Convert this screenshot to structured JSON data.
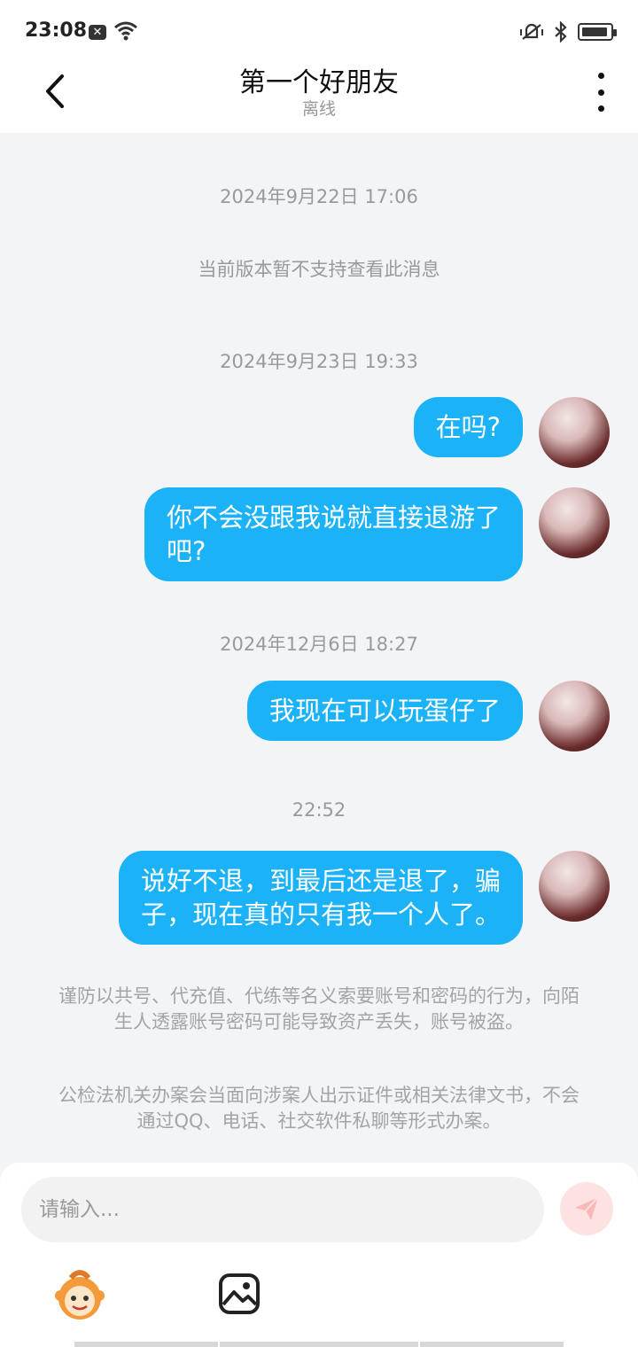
{
  "status": {
    "time": "23:08"
  },
  "header": {
    "title": "第一个好朋友",
    "subtitle": "离线"
  },
  "chat": {
    "items": [
      {
        "type": "time",
        "text": "2024年9月22日 17:06"
      },
      {
        "type": "system",
        "text": "当前版本暂不支持查看此消息"
      },
      {
        "type": "time",
        "text": "2024年9月23日 19:33"
      },
      {
        "type": "message",
        "text": "在吗?"
      },
      {
        "type": "message",
        "line1": "你不会没跟我说就直接退游了",
        "line2": "吧?"
      },
      {
        "type": "time",
        "text": "2024年12月6日 18:27"
      },
      {
        "type": "message",
        "text": "我现在可以玩蛋仔了"
      },
      {
        "type": "time",
        "text": "22:52"
      },
      {
        "type": "message",
        "line1": "说好不退，到最后还是退了，骗",
        "line2": "子，现在真的只有我一个人了。"
      }
    ],
    "notice1": "谨防以共号、代充值、代练等名义索要账号和密码的行为，向陌生人透露账号密码可能导致资产丢失，账号被盗。",
    "notice2": "公检法机关办案会当面向涉案人出示证件或相关法律文书，不会通过QQ、电话、社交软件私聊等形式办案。"
  },
  "input": {
    "placeholder": "请输入..."
  },
  "colors": {
    "bubble": "#1cb2f7",
    "background": "#f2f4f6"
  }
}
